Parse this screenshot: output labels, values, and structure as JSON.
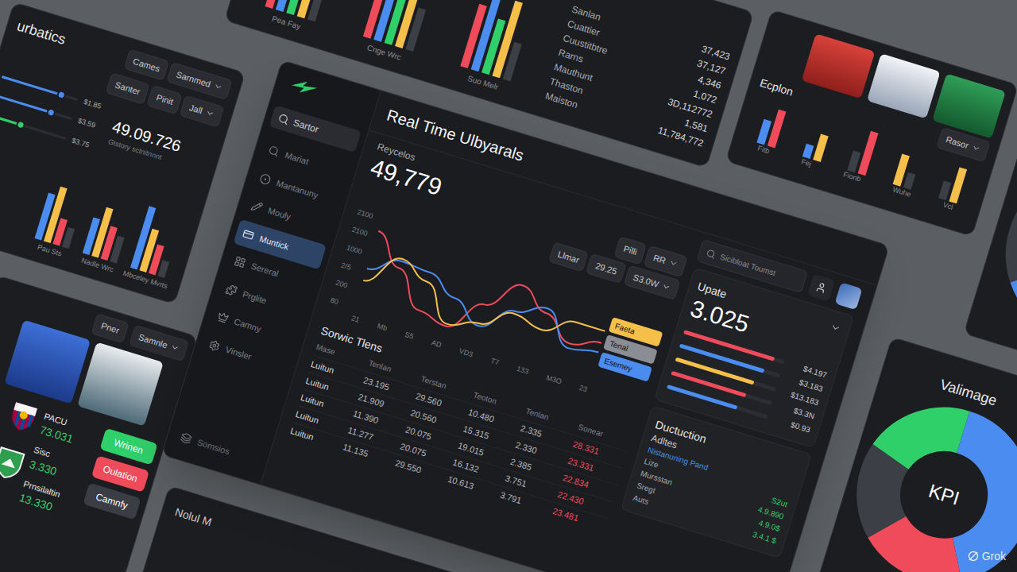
{
  "watermark": "Grok",
  "main": {
    "title": "Real Time Ulbyarals",
    "sidebar": {
      "search": "Sartor",
      "items": [
        {
          "label": "Mariat",
          "selected": false
        },
        {
          "label": "Mantanuny",
          "selected": false
        },
        {
          "label": "Mouly",
          "selected": false
        },
        {
          "label": "Muntick",
          "selected": true
        },
        {
          "label": "Sereral",
          "selected": false
        },
        {
          "label": "Prglite",
          "selected": false
        },
        {
          "label": "Camny",
          "selected": false
        },
        {
          "label": "Vinsler",
          "selected": false
        }
      ],
      "footer": "Somsios"
    },
    "stat": {
      "label": "Reycelos",
      "value": "49,779"
    },
    "chart": {
      "toolbar": [
        {
          "label": "Pilli",
          "dropdown": false
        },
        {
          "label": "RR",
          "dropdown": true
        }
      ],
      "filters": [
        {
          "label": "Llmar",
          "dropdown": false
        },
        {
          "label": "29.25",
          "dropdown": false
        },
        {
          "label": "S3.0W",
          "dropdown": true
        }
      ],
      "y_ticks": [
        "2100",
        "2100",
        "1000",
        "2/5",
        "200",
        "80"
      ],
      "x_ticks": [
        "21",
        "Mb",
        "S5",
        "AD",
        "VD3",
        "T7",
        "133",
        "M3O",
        "23"
      ],
      "series": [
        {
          "color": "#ef4b5b",
          "values": [
            1750,
            1150,
            450,
            300,
            950,
            1550,
            1150,
            700,
            900
          ]
        },
        {
          "color": "#4a8cf0",
          "values": [
            950,
            1300,
            1250,
            900,
            500,
            1000,
            1250,
            600,
            700
          ]
        },
        {
          "color": "#f5c04a",
          "values": [
            700,
            1350,
            1050,
            350,
            550,
            950,
            800,
            1150,
            1150
          ]
        }
      ],
      "legend": [
        {
          "label": "Faeta",
          "color": "#f5c04a"
        },
        {
          "label": "Tenal",
          "color": "#8a8d93"
        },
        {
          "label": "Esemey",
          "color": "#4a8cf0"
        }
      ]
    },
    "table": {
      "title": "Sorwic Tlens",
      "columns": [
        "Mase",
        "Tenlan",
        "Terstan",
        "Teoton",
        "Tenlan",
        "Sonear"
      ],
      "rows": [
        [
          "Luitun",
          "23.195",
          "29.560",
          "10.480",
          "2.335",
          "28.331"
        ],
        [
          "Luitun",
          "21.909",
          "20.560",
          "15.315",
          "2.330",
          "23.331"
        ],
        [
          "Luitun",
          "11.390",
          "20.075",
          "19.015",
          "2.385",
          "22.834"
        ],
        [
          "Luitun",
          "11.277",
          "20.075",
          "16.132",
          "3.751",
          "22.430"
        ],
        [
          "Luitun",
          "11.135",
          "29.550",
          "10.613",
          "3.791",
          "23.481"
        ]
      ]
    },
    "right": {
      "search": "Sicibloat Toumst",
      "update": {
        "label": "Upate",
        "value": "3.025",
        "bars": [
          {
            "level": 0.9,
            "color": "#ef4b5b",
            "reading": "$4.197"
          },
          {
            "level": 0.84,
            "color": "#4a8cf0",
            "reading": "$3.183"
          },
          {
            "level": 0.78,
            "color": "#f5c04a",
            "reading": "$13.183"
          },
          {
            "level": 0.74,
            "color": "#ef4b5b",
            "reading": "$3.3N"
          },
          {
            "level": 0.7,
            "color": "#4a8cf0",
            "reading": "$0.93"
          }
        ]
      },
      "section": {
        "title": "Ductuction",
        "subtitle": "Adltes",
        "link": "Nistanuning Pand",
        "rows": [
          {
            "label": "Lize",
            "value": "S2ut"
          },
          {
            "label": "Mursstan",
            "value": "4.9.890"
          },
          {
            "label": "Sregt",
            "value": "4.9.0$"
          },
          {
            "label": "Auts",
            "value": "3.4.1 $"
          }
        ]
      }
    }
  },
  "stats_panel": {
    "title": "urbatics",
    "button": "Cames",
    "dropdown": "Sarnmed",
    "filters": [
      {
        "label": "Santer",
        "dropdown": false
      },
      {
        "label": "Pinit",
        "dropdown": false
      },
      {
        "label": "Jall",
        "dropdown": true
      }
    ],
    "sliders": [
      {
        "level": 0.78,
        "color": "#4a8cf0",
        "reading": "$1.85"
      },
      {
        "level": 0.72,
        "color": "#4a8cf0",
        "reading": "$3.59"
      },
      {
        "level": 0.4,
        "color": "#2fcf6a",
        "reading": "$3.75"
      }
    ],
    "value": "49.09.726",
    "caption": "Gtstory sctnitnnnt",
    "series": [
      {
        "color": "#4a8cf0"
      },
      {
        "color": "#f5c04a"
      },
      {
        "color": "#ef4b5b"
      },
      {
        "color": "#3c3f45"
      }
    ],
    "groups": [
      {
        "label": "Pau Sts",
        "values": [
          70,
          85,
          40,
          30
        ]
      },
      {
        "label": "Nadle Wrc",
        "values": [
          55,
          75,
          50,
          40
        ]
      },
      {
        "label": "Mbceley Mvrts",
        "values": [
          95,
          65,
          45,
          25
        ]
      }
    ]
  },
  "feed_panel": {
    "series": [
      {
        "color": "#ef4b5b"
      },
      {
        "color": "#4a8cf0"
      },
      {
        "color": "#2fcf6a"
      },
      {
        "color": "#f5c04a"
      },
      {
        "color": "#3c3f45"
      }
    ],
    "groups": [
      {
        "label": "Pea Fay",
        "values": [
          80,
          95,
          60,
          70,
          40
        ]
      },
      {
        "label": "Cnge Wrc",
        "values": [
          90,
          70,
          85,
          100,
          50
        ]
      },
      {
        "label": "Suo Melr",
        "values": [
          75,
          100,
          65,
          90,
          45
        ]
      }
    ],
    "rows": [
      {
        "label": "Sanlan",
        "value": "37,423"
      },
      {
        "label": "Cuattier",
        "value": "37,127"
      },
      {
        "label": "Cuustitbtre",
        "value": "4,346"
      },
      {
        "label": "Rarns",
        "value": "1,072"
      },
      {
        "label": "Mauthunt",
        "value": "3D,112772"
      },
      {
        "label": "Thaston",
        "value": "1,581"
      },
      {
        "label": "Maiston",
        "value": "11,784,772"
      }
    ]
  },
  "players_panel": {
    "title": "Ecplon",
    "dropdown": "Rasor",
    "groups": [
      {
        "label": "Fitb",
        "bars": [
          {
            "value": 55,
            "color": "#4a8cf0"
          },
          {
            "value": 85,
            "color": "#ef4b5b"
          }
        ]
      },
      {
        "label": "Fej",
        "bars": [
          {
            "value": 30,
            "color": "#4a8cf0"
          },
          {
            "value": 60,
            "color": "#f5c04a"
          }
        ]
      },
      {
        "label": "Fionb",
        "bars": [
          {
            "value": 45,
            "color": "#3c3f45"
          },
          {
            "value": 100,
            "color": "#ef4b5b"
          }
        ]
      },
      {
        "label": "Wuhe",
        "bars": [
          {
            "value": 70,
            "color": "#f5c04a"
          },
          {
            "value": 35,
            "color": "#3c3f45"
          }
        ]
      },
      {
        "label": "Vcl",
        "bars": [
          {
            "value": 40,
            "color": "#3c3f45"
          },
          {
            "value": 80,
            "color": "#f5c04a"
          }
        ]
      }
    ]
  },
  "teams_panel": {
    "button": "Pner",
    "dropdown": "Samnle",
    "teams": [
      {
        "name": "PACU",
        "score": "73.031"
      },
      {
        "name": "Sisc",
        "score": "3.330"
      },
      {
        "name": "Prnsilaltin",
        "score": "13.330"
      }
    ],
    "actions": [
      {
        "label": "Wrinen",
        "color": "#2fcf6a"
      },
      {
        "label": "Oulation",
        "color": "#ef4b5b"
      },
      {
        "label": "Camnfy",
        "color": "#3a3d44"
      }
    ]
  },
  "side_donut": {
    "segments": [
      {
        "value": 20,
        "color": "#2fcf6a"
      },
      {
        "value": 45,
        "color": "#4a8cf0"
      },
      {
        "value": 35,
        "color": "#3c3f45"
      }
    ]
  },
  "kpi_panel": {
    "title": "Valimage",
    "center": "KPI",
    "segments": [
      {
        "value": 42,
        "color": "#4a8cf0"
      },
      {
        "value": 20,
        "color": "#ef4b5b"
      },
      {
        "value": 18,
        "color": "#3c3f45"
      },
      {
        "value": 20,
        "color": "#2fcf6a"
      }
    ]
  },
  "bottom_panel": {
    "title": "Nolul M"
  }
}
